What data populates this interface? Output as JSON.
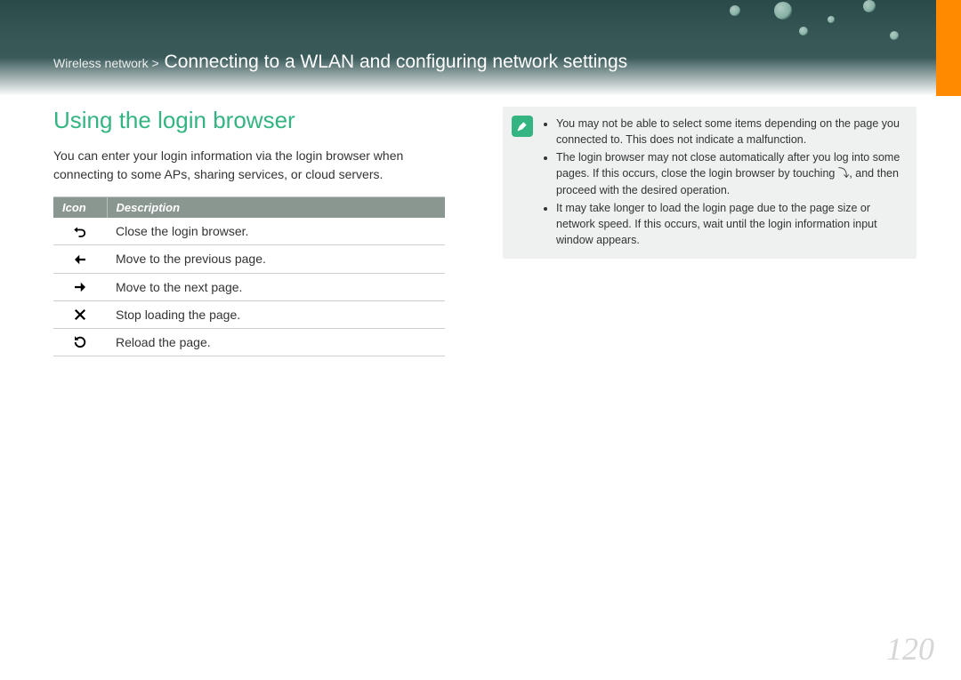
{
  "header": {
    "breadcrumb_prefix": "Wireless network >",
    "title": "Connecting to a WLAN and configuring network settings"
  },
  "section": {
    "heading": "Using the login browser",
    "intro": "You can enter your login information via the login browser when connecting to some APs, sharing services, or cloud servers."
  },
  "table": {
    "header_icon": "Icon",
    "header_desc": "Description",
    "rows": [
      {
        "icon": "back-return-icon",
        "desc": "Close the login browser."
      },
      {
        "icon": "arrow-left-icon",
        "desc": "Move to the previous page."
      },
      {
        "icon": "arrow-right-icon",
        "desc": "Move to the next page."
      },
      {
        "icon": "close-x-icon",
        "desc": "Stop loading the page."
      },
      {
        "icon": "reload-icon",
        "desc": "Reload the page."
      }
    ]
  },
  "notes": {
    "items": [
      "You may not be able to select some items depending on the page you connected to. This does not indicate a malfunction.",
      "The login browser may not close automatically after you log into some pages. If this occurs, close the login browser by touching ⤵, and then proceed with the desired operation.",
      "It may take longer to load the login page due to the page size or network speed. If this occurs, wait until the login information input window appears."
    ]
  },
  "page_number": "120",
  "colors": {
    "accent": "#33b480",
    "tab": "#ff8a00",
    "table_header": "#8a9690"
  }
}
